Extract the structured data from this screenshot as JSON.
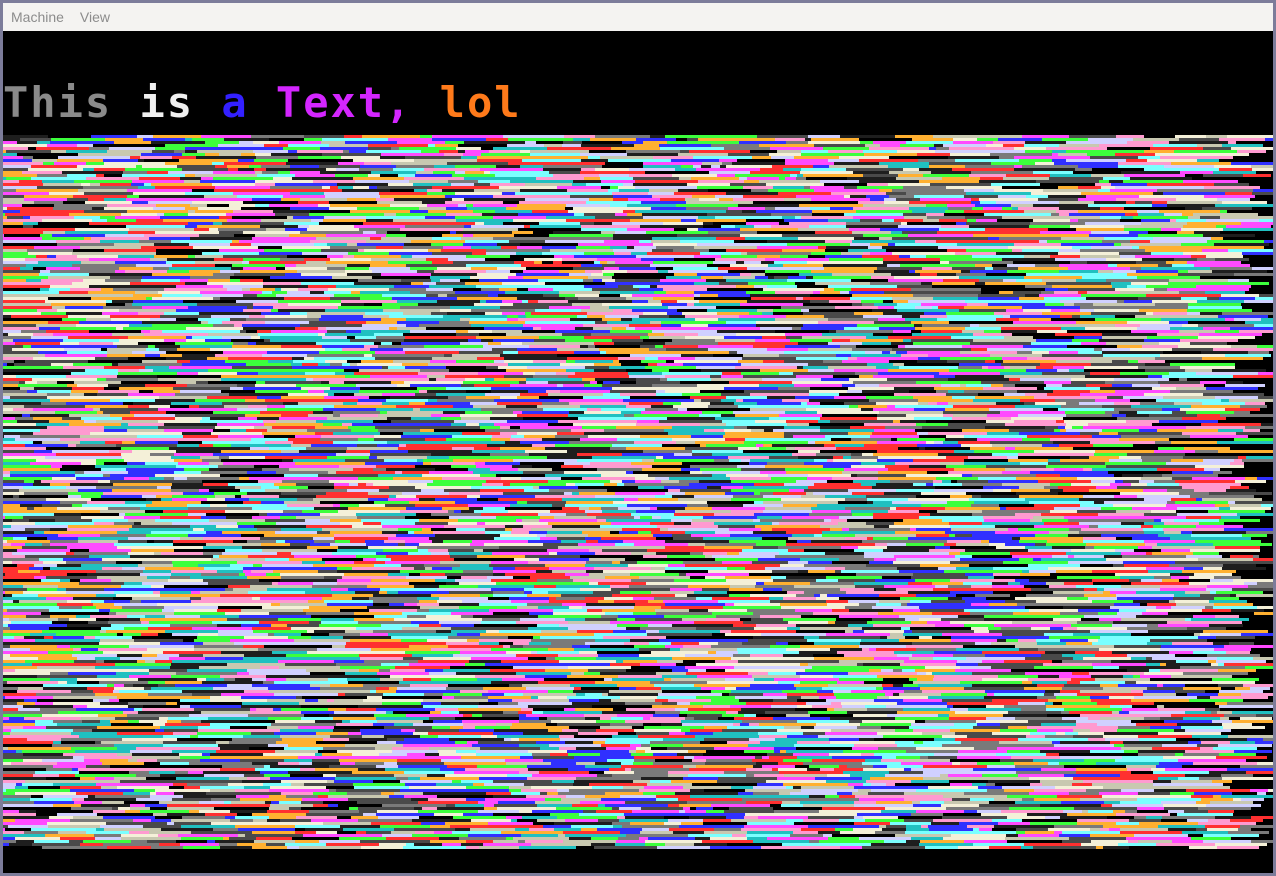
{
  "menubar": {
    "items": [
      {
        "label": "Machine"
      },
      {
        "label": "View"
      }
    ]
  },
  "screen": {
    "text_segments": [
      {
        "text": "This",
        "color": "#8a8a8a"
      },
      {
        "text": " ",
        "color": "#000000"
      },
      {
        "text": "is",
        "color": "#f0f0f0"
      },
      {
        "text": " ",
        "color": "#000000"
      },
      {
        "text": "a",
        "color": "#3320ff"
      },
      {
        "text": " ",
        "color": "#000000"
      },
      {
        "text": "Text,",
        "color": "#d426ff"
      },
      {
        "text": " ",
        "color": "#000000"
      },
      {
        "text": "lol",
        "color": "#ff7a1a"
      }
    ],
    "background": "#000000",
    "noise_palette": [
      "#f4f0d8",
      "#c8c8b0",
      "#7a7a7a",
      "#4a4a4a",
      "#1e1e1e",
      "#ff4aff",
      "#ff9ad0",
      "#3cff3c",
      "#20c0c0",
      "#7affff",
      "#3030ff",
      "#ff3030",
      "#ffb030",
      "#d0d0ff",
      "#000000"
    ]
  }
}
